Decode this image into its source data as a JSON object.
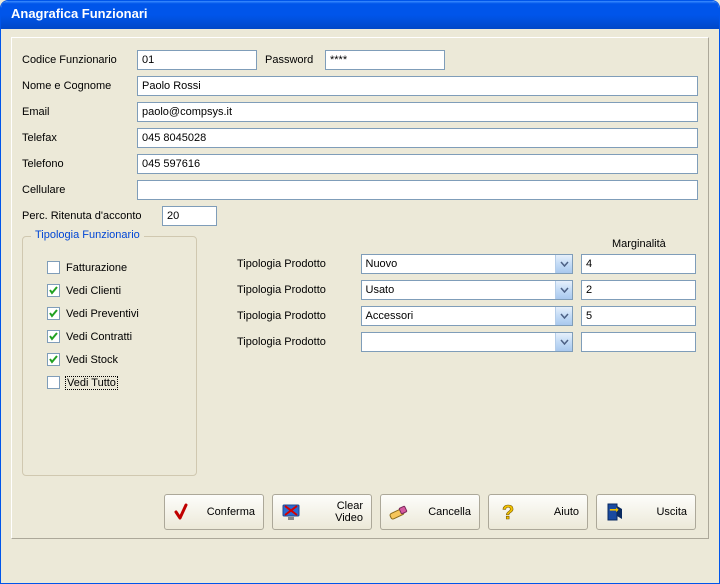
{
  "window": {
    "title": "Anagrafica Funzionari"
  },
  "labels": {
    "codice": "Codice Funzionario",
    "password": "Password",
    "nome": "Nome e Cognome",
    "email": "Email",
    "telefax": "Telefax",
    "telefono": "Telefono",
    "cellulare": "Cellulare",
    "ritenuta": "Perc. Ritenuta d'acconto",
    "tipologia_group": "Tipologia Funzionario",
    "tipologia_prodotto": "Tipologia Prodotto",
    "marginalita": "Marginalità"
  },
  "fields": {
    "codice": "01",
    "password": "****",
    "nome": "Paolo Rossi",
    "email": "paolo@compsys.it",
    "telefax": "045 8045028",
    "telefono": "045 597616",
    "cellulare": "",
    "ritenuta": "20"
  },
  "checks": {
    "fatturazione": {
      "label": "Fatturazione",
      "checked": false
    },
    "vedi_clienti": {
      "label": "Vedi Clienti",
      "checked": true
    },
    "vedi_preventivi": {
      "label": "Vedi Preventivi",
      "checked": true
    },
    "vedi_contratti": {
      "label": "Vedi Contratti",
      "checked": true
    },
    "vedi_stock": {
      "label": "Vedi Stock",
      "checked": true
    },
    "vedi_tutto": {
      "label": "Vedi Tutto",
      "checked": false,
      "focused": true
    }
  },
  "products": [
    {
      "tipo": "Nuovo",
      "marg": "4"
    },
    {
      "tipo": "Usato",
      "marg": "2"
    },
    {
      "tipo": "Accessori",
      "marg": "5"
    },
    {
      "tipo": "",
      "marg": ""
    }
  ],
  "buttons": {
    "conferma": "Conferma",
    "clear": "Clear Video",
    "cancella": "Cancella",
    "aiuto": "Aiuto",
    "uscita": "Uscita"
  }
}
